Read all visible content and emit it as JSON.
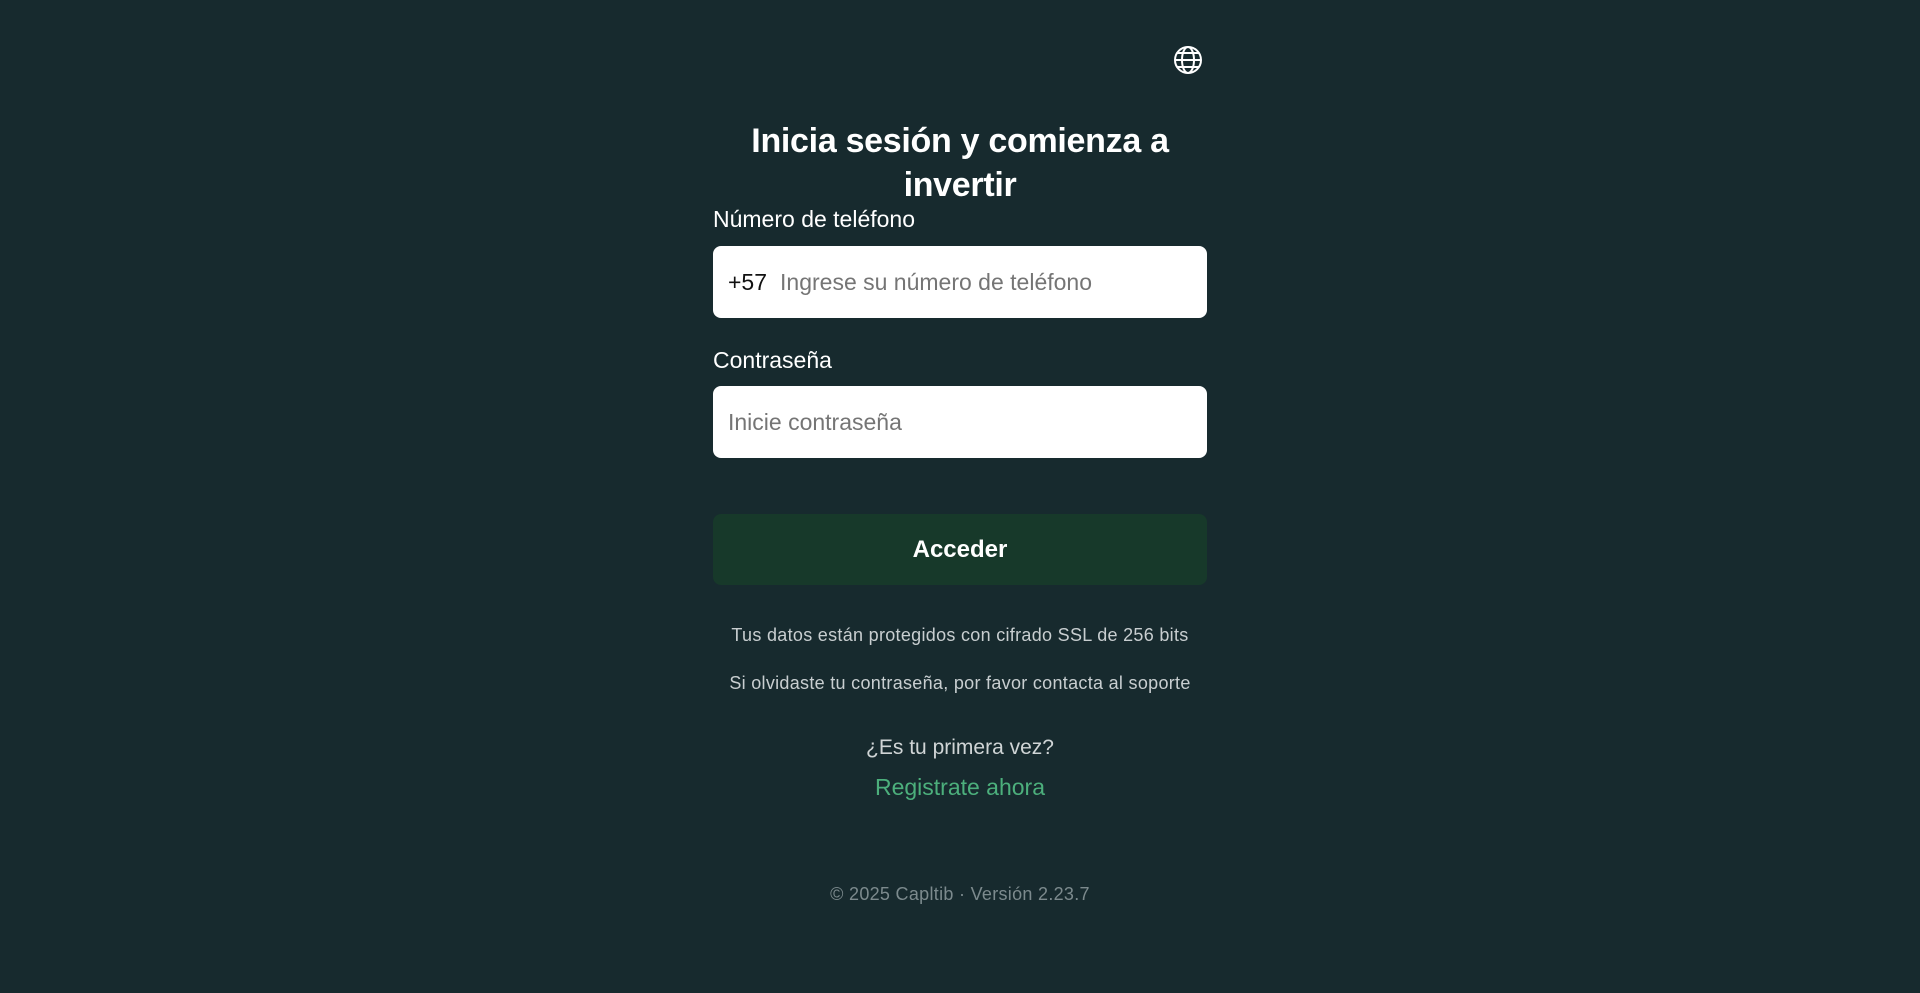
{
  "header": {
    "language_icon": "globe-icon"
  },
  "login": {
    "title": "Inicia sesión y comienza a invertir",
    "phone_label": "Número de teléfono",
    "phone_prefix": "+57",
    "phone_placeholder": "Ingrese su número de teléfono",
    "phone_value": "",
    "password_label": "Contraseña",
    "password_placeholder": "Inicie contraseña",
    "password_value": "",
    "submit_label": "Acceder",
    "ssl_note": "Tus datos están protegidos con cifrado SSL de 256 bits",
    "forgot_note": "Si olvidaste tu contraseña, por favor contacta al soporte",
    "first_time_text": "¿Es tu primera vez?",
    "register_link": "Registrate ahora"
  },
  "footer": {
    "text": "© 2025 Capltib · Versión 2.23.7"
  },
  "colors": {
    "background": "#172a2e",
    "button": "#17392a",
    "link": "#4caf7c"
  }
}
